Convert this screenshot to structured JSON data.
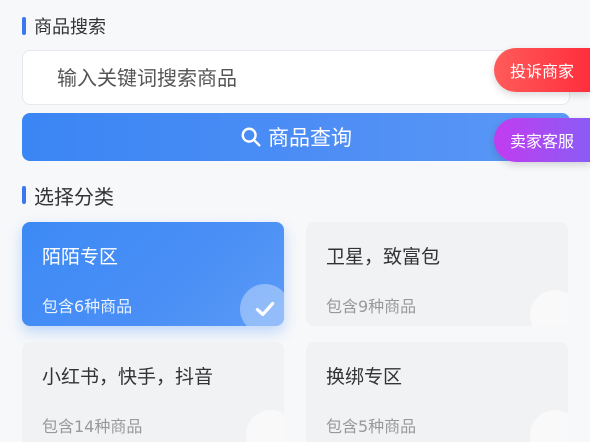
{
  "search_section": {
    "title": "商品搜索",
    "placeholder": "输入关键词搜索商品",
    "button_label": "商品查询"
  },
  "floating_buttons": {
    "complain_label": "投诉商家",
    "service_label": "卖家客服"
  },
  "category_section": {
    "title": "选择分类",
    "categories": [
      {
        "name": "陌陌专区",
        "count_text": "包含6种商品",
        "selected": true
      },
      {
        "name": "卫星，致富包",
        "count_text": "包含9种商品",
        "selected": false
      },
      {
        "name": "小红书，快手，抖音",
        "count_text": "包含14种商品",
        "selected": false
      },
      {
        "name": "换绑专区",
        "count_text": "包含5种商品",
        "selected": false
      }
    ]
  },
  "colors": {
    "accent": "#3b78f0",
    "complain": "#ff2e3d",
    "service": "#a14cf2"
  },
  "icons": {
    "search_button": "search-icon",
    "selected_mark": "check-icon"
  }
}
